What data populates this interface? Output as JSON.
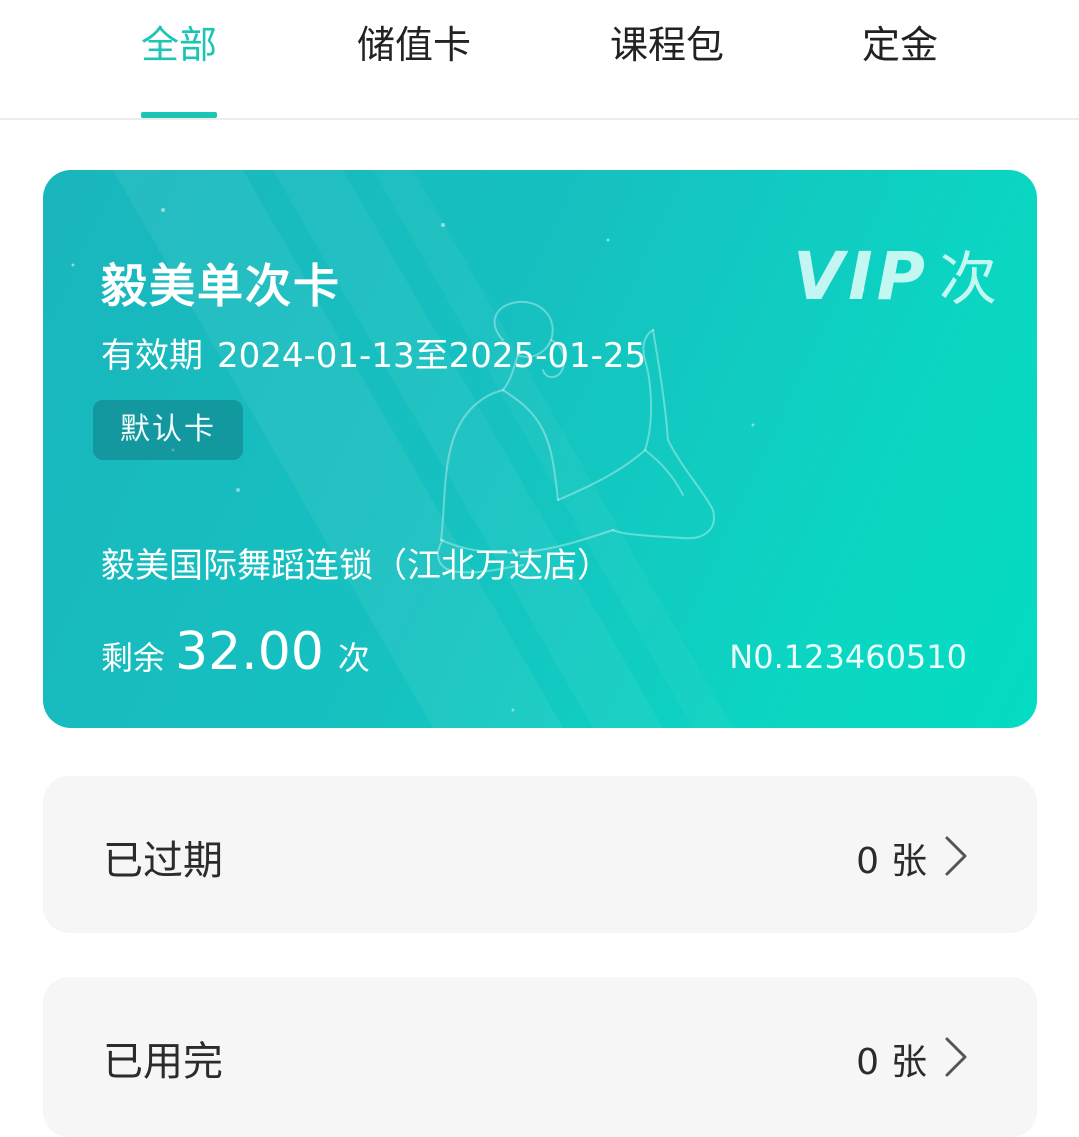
{
  "tabs": [
    {
      "label": "全部",
      "active": true
    },
    {
      "label": "储值卡",
      "active": false
    },
    {
      "label": "课程包",
      "active": false
    },
    {
      "label": "定金",
      "active": false
    }
  ],
  "card": {
    "title": "毅美单次卡",
    "validity_label": "有效期",
    "validity_range": "2024-01-13至2025-01-25",
    "default_badge": "默认卡",
    "store_name": "毅美国际舞蹈连锁（江北万达店）",
    "remaining_label": "剩余",
    "remaining_value": "32.00",
    "remaining_unit": "次",
    "card_number": "N0.123460510",
    "vip_text": "VIP",
    "vip_type": "次",
    "gradient_start": "#19b6bd",
    "gradient_end": "#04dcc3"
  },
  "summary": {
    "expired": {
      "label": "已过期",
      "count": "0",
      "unit": "张"
    },
    "used_up": {
      "label": "已用完",
      "count": "0",
      "unit": "张"
    }
  },
  "colors": {
    "accent": "#1cc4b4",
    "row_background": "#f6f6f6",
    "text_primary": "#2b2b2b"
  },
  "icons": {
    "row_arrow": "chevron-right-icon",
    "card_decoration": "dancer-illustration"
  }
}
